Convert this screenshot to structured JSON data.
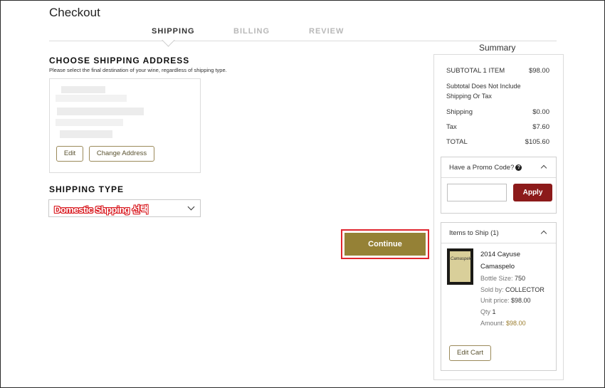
{
  "page": {
    "title": "Checkout"
  },
  "steps": [
    {
      "label": "SHIPPING",
      "active": true
    },
    {
      "label": "BILLING",
      "active": false
    },
    {
      "label": "REVIEW",
      "active": false
    }
  ],
  "shipping_address": {
    "title": "CHOOSE SHIPPING ADDRESS",
    "subtitle": "Please select the final destination of your wine, regardless of shipping type.",
    "edit_label": "Edit",
    "change_label": "Change Address"
  },
  "shipping_type": {
    "title": "SHIPPING TYPE",
    "selected": "Domestic Shpping 선택"
  },
  "continue_label": "Continue",
  "summary": {
    "title": "Summary",
    "subtotal_label": "SUBTOTAL 1 ITEM",
    "subtotal_value": "$98.00",
    "note": "Subtotal Does Not Include Shipping Or Tax",
    "shipping_label": "Shipping",
    "shipping_value": "$0.00",
    "tax_label": "Tax",
    "tax_value": "$7.60",
    "total_label": "TOTAL",
    "total_value": "$105.60"
  },
  "promo": {
    "header": "Have a Promo Code?",
    "apply_label": "Apply",
    "input_value": ""
  },
  "items_panel": {
    "header": "Items to Ship (1)",
    "item": {
      "name_line1": "2014 Cayuse",
      "name_line2": "Camaspelo",
      "bottle_size_label": "Bottle Size:",
      "bottle_size": "750",
      "sold_by_label": "Sold by:",
      "sold_by": "COLLECTOR",
      "unit_price_label": "Unit price:",
      "unit_price": "$98.00",
      "qty_label": "Qty",
      "qty": "1",
      "amount_label": "Amount:",
      "amount": "$98.00",
      "label_text": "Camaspelo"
    },
    "edit_cart_label": "Edit Cart"
  },
  "colors": {
    "accent_gold": "#958136",
    "apply_red": "#8c1a1a",
    "highlight_red": "#e0242e"
  }
}
